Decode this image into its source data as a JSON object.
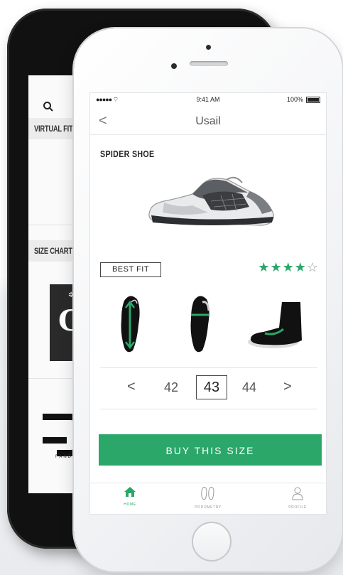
{
  "back_screen": {
    "section1_label": "VIRTUAL FIT",
    "section2_label": "SIZE CHARTS",
    "brand_caption": "FANDMA"
  },
  "status_bar": {
    "signal": "●●●●● ",
    "time": "9:41 AM",
    "battery": "100%"
  },
  "nav": {
    "back_glyph": "<",
    "title": "Usail"
  },
  "product": {
    "name": "SPIDER SHOE",
    "best_fit_label": "BEST FIT",
    "rating": 4,
    "rating_max": 5
  },
  "size_selector": {
    "prev_glyph": "<",
    "next_glyph": ">",
    "sizes": [
      "42",
      "43",
      "44"
    ],
    "selected": "43"
  },
  "buy_button": {
    "label": "BUY THIS SIZE"
  },
  "tabbar": {
    "home": "HOME",
    "podometry": "PODOMETRY",
    "profile": "PROFILE"
  },
  "colors": {
    "accent": "#2aa769",
    "text": "#222222",
    "muted": "#999999"
  }
}
